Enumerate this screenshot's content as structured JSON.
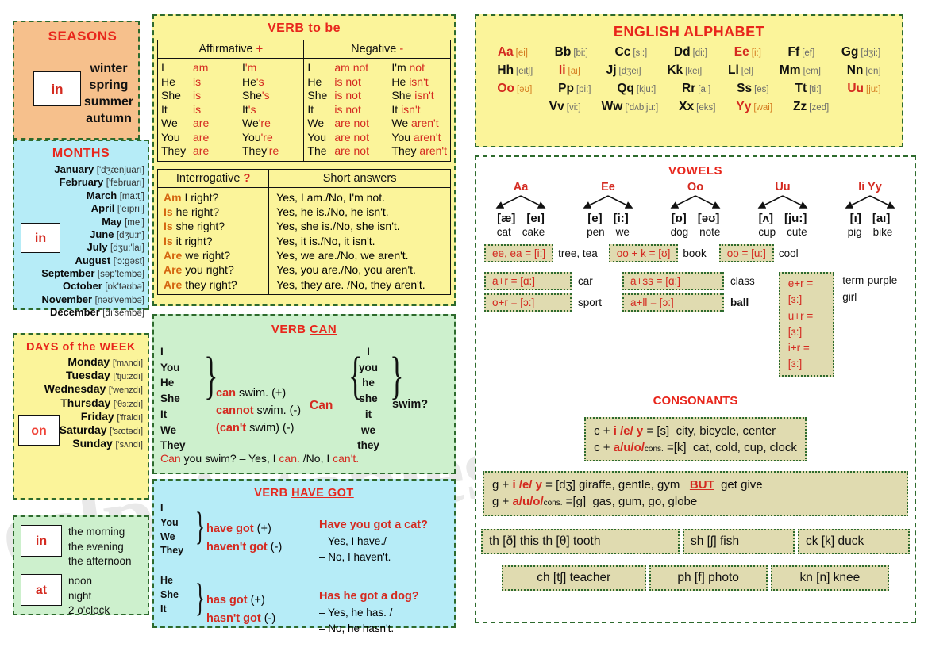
{
  "seasons": {
    "title": "SEASONS",
    "prep": "in",
    "items": [
      "winter",
      "spring",
      "summer",
      "autumn"
    ]
  },
  "months": {
    "title": "MONTHS",
    "prep": "in",
    "items": [
      {
        "name": "January",
        "ipa": "['dʒænjuarı]"
      },
      {
        "name": "February",
        "ipa": "['februarı]"
      },
      {
        "name": "March",
        "ipa": "[ma:tʃ]"
      },
      {
        "name": "April",
        "ipa": "['eıprıl]"
      },
      {
        "name": "May",
        "ipa": "[mei]"
      },
      {
        "name": "June",
        "ipa": "[dʒu:n]"
      },
      {
        "name": "July",
        "ipa": "[dʒu:'laı]"
      },
      {
        "name": "August",
        "ipa": "['ɔ:gəst]"
      },
      {
        "name": "September",
        "ipa": "[səp'tembə]"
      },
      {
        "name": "October",
        "ipa": "[ɒk'təʊbə]"
      },
      {
        "name": "November",
        "ipa": "[nəʊ'vembə]"
      },
      {
        "name": "December",
        "ipa": "[dı'sembə]"
      }
    ]
  },
  "days": {
    "title": "DAYS of the WEEK",
    "prep": "on",
    "items": [
      {
        "name": "Monday",
        "ipa": "['mʌndı]"
      },
      {
        "name": "Tuesday",
        "ipa": "['tju:zdı]"
      },
      {
        "name": "Wednesday",
        "ipa": "['wenzdı]"
      },
      {
        "name": "Thursday",
        "ipa": "['θɜ:zdı]"
      },
      {
        "name": "Friday",
        "ipa": "['fraidı]"
      },
      {
        "name": "Saturday",
        "ipa": "['sætədı]"
      },
      {
        "name": "Sunday",
        "ipa": "['sʌndı]"
      }
    ]
  },
  "timebox": {
    "prep_in": "in",
    "in_items": [
      "the morning",
      "the evening",
      "the afternoon"
    ],
    "prep_at": "at",
    "at_items": [
      "noon",
      "night",
      "2 o'clock"
    ]
  },
  "tobe": {
    "title_plain": "VERB ",
    "title_underlined": "to be",
    "head_affirmative": "Affirmative",
    "head_affirmative_sign": "+",
    "head_negative": "Negative",
    "head_negative_sign": "-",
    "affirmative": [
      {
        "subj": "I",
        "verb": "am",
        "short": "I'm"
      },
      {
        "subj": "He",
        "verb": "is",
        "short": "He's"
      },
      {
        "subj": "She",
        "verb": "is",
        "short": "She's"
      },
      {
        "subj": "It",
        "verb": "is",
        "short": "It's"
      },
      {
        "subj": "We",
        "verb": "are",
        "short": "We're"
      },
      {
        "subj": "You",
        "verb": "are",
        "short": "You're"
      },
      {
        "subj": "They",
        "verb": "are",
        "short": "They're"
      }
    ],
    "negative": [
      {
        "subj": "I",
        "verb": "am not",
        "short_subj": "I'm",
        "short_verb": "not"
      },
      {
        "subj": "He",
        "verb": "is not",
        "short_subj": "He",
        "short_verb": "isn't"
      },
      {
        "subj": "She",
        "verb": "is not",
        "short_subj": "She",
        "short_verb": "isn't"
      },
      {
        "subj": "It",
        "verb": "is not",
        "short_subj": "It",
        "short_verb": "isn't"
      },
      {
        "subj": "We",
        "verb": "are not",
        "short_subj": "We",
        "short_verb": "aren't"
      },
      {
        "subj": "You",
        "verb": "are not",
        "short_subj": "You",
        "short_verb": "aren't"
      },
      {
        "subj": "The",
        "verb": "are not",
        "short_subj": "They",
        "short_verb": "aren't"
      }
    ],
    "head_interrogative": "Interrogative",
    "head_interrogative_sign": "?",
    "head_short_answers": "Short answers",
    "qa": [
      {
        "q_word": "Am",
        "q_rest": "I right?",
        "a": "Yes, I am./No, I'm not."
      },
      {
        "q_word": "Is",
        "q_rest": "he right?",
        "a": "Yes, he is./No, he isn't."
      },
      {
        "q_word": "Is",
        "q_rest": "she right?",
        "a": "Yes, she is./No, she isn't."
      },
      {
        "q_word": "Is",
        "q_rest": "it right?",
        "a": "Yes, it is./No, it isn't."
      },
      {
        "q_word": "Are",
        "q_rest": "we right?",
        "a": "Yes, we are./No, we aren't."
      },
      {
        "q_word": "Are",
        "q_rest": "you right?",
        "a": "Yes, you are./No, you aren't."
      },
      {
        "q_word": "Are",
        "q_rest": "they right?",
        "a": "Yes, they are. /No, they aren't."
      }
    ]
  },
  "verbcan": {
    "title_plain": "VERB  ",
    "title_underlined": "CAN",
    "pronouns_left": [
      "I",
      "You",
      "He",
      "She",
      "It",
      "We",
      "They"
    ],
    "forms": [
      {
        "modal": "can",
        "rest": " swim. (+)"
      },
      {
        "modal": "cannot",
        "rest": " swim. (-)"
      },
      {
        "modal": "(can't",
        "rest": " swim)  (-)"
      }
    ],
    "question_word": "Can",
    "pronouns_right": [
      "I",
      "you",
      "he",
      "she",
      "it",
      "we",
      "they"
    ],
    "question_verb": "swim?",
    "example_q": "Can",
    "example_rest": " you swim? – Yes, I ",
    "example_yes": "can.",
    "example_mid": " /No, I ",
    "example_no": "can't."
  },
  "havegot": {
    "title_plain": "VERB  ",
    "title_underlined": "HAVE GOT",
    "group1_pronouns": [
      "I",
      "You",
      "We",
      "They"
    ],
    "group1_forms": [
      {
        "form": "have got",
        "sign": "(+)"
      },
      {
        "form": "haven't got",
        "sign": "(-)"
      }
    ],
    "group1_question": "Have you got a cat?",
    "group1_answers": [
      "– Yes, I  have./",
      "– No, I haven't."
    ],
    "group2_pronouns": [
      "He",
      "She",
      "It"
    ],
    "group2_forms": [
      {
        "form": "has got",
        "sign": "(+)"
      },
      {
        "form": "hasn't got",
        "sign": "(-)"
      }
    ],
    "group2_question": "Has he got a dog?",
    "group2_answers": [
      "– Yes, he has. /",
      "– No, he hasn't."
    ]
  },
  "alphabet": {
    "title": "ENGLISH ALPHABET",
    "rows": [
      [
        {
          "letter": "Aa",
          "ipa": "[ei]",
          "vowel": true
        },
        {
          "letter": "Bb",
          "ipa": "[bi:]",
          "vowel": false
        },
        {
          "letter": "Cc",
          "ipa": "[si:]",
          "vowel": false
        },
        {
          "letter": "Dd",
          "ipa": "[di:]",
          "vowel": false
        },
        {
          "letter": "Ee",
          "ipa": "[i:]",
          "vowel": true
        },
        {
          "letter": "Ff",
          "ipa": "[ef]",
          "vowel": false
        },
        {
          "letter": "Gg",
          "ipa": "[dʒi:]",
          "vowel": false
        }
      ],
      [
        {
          "letter": "Hh",
          "ipa": "[eitʃ]",
          "vowel": false
        },
        {
          "letter": "Ii",
          "ipa": "[ai]",
          "vowel": true
        },
        {
          "letter": "Jj",
          "ipa": "[dʒei]",
          "vowel": false
        },
        {
          "letter": "Kk",
          "ipa": "[kei]",
          "vowel": false
        },
        {
          "letter": "Ll",
          "ipa": "[el]",
          "vowel": false
        },
        {
          "letter": "Mm",
          "ipa": "[em]",
          "vowel": false
        },
        {
          "letter": "Nn",
          "ipa": "[en]",
          "vowel": false
        }
      ],
      [
        {
          "letter": "Oo",
          "ipa": "[əʊ]",
          "vowel": true
        },
        {
          "letter": "Pp",
          "ipa": "[pi:]",
          "vowel": false
        },
        {
          "letter": "Qq",
          "ipa": "[kju:]",
          "vowel": false
        },
        {
          "letter": "Rr",
          "ipa": "[a:]",
          "vowel": false
        },
        {
          "letter": "Ss",
          "ipa": "[es]",
          "vowel": false
        },
        {
          "letter": "Tt",
          "ipa": "[ti:]",
          "vowel": false
        },
        {
          "letter": "Uu",
          "ipa": "[ju:]",
          "vowel": true
        }
      ],
      [
        {
          "letter": "Vv",
          "ipa": "[vi:]",
          "vowel": false
        },
        {
          "letter": "Ww",
          "ipa": "['dʌblju:]",
          "vowel": false
        },
        {
          "letter": "Xx",
          "ipa": "[eks]",
          "vowel": false
        },
        {
          "letter": "Yy",
          "ipa": "[wai]",
          "vowel": true
        },
        {
          "letter": "Zz",
          "ipa": "[zed]",
          "vowel": false
        }
      ]
    ]
  },
  "vowels": {
    "title": "VOWELS",
    "groups": [
      {
        "head": "Aa",
        "left_ipa": "[æ]",
        "left_word": "cat",
        "right_ipa": "[eı]",
        "right_word": "cake"
      },
      {
        "head": "Ee",
        "left_ipa": "[e]",
        "left_word": "pen",
        "right_ipa": "[i:]",
        "right_word": "we"
      },
      {
        "head": "Oo",
        "left_ipa": "[ɒ]",
        "left_word": "dog",
        "right_ipa": "[əʊ]",
        "right_word": "note"
      },
      {
        "head": "Uu",
        "left_ipa": "[ʌ]",
        "left_word": "cup",
        "right_ipa": "[ju:]",
        "right_word": "cute"
      },
      {
        "head": "Ii Yy",
        "left_ipa": "[ı]",
        "left_word": "pig",
        "right_ipa": "[aı]",
        "right_word": "bike"
      }
    ],
    "rules_row1": [
      {
        "rule": "ee, ea = [i:]",
        "examples": "tree, tea"
      },
      {
        "rule": "oo + k = [ʊ]",
        "examples": "book"
      },
      {
        "rule": "oo = [u:]",
        "examples": "cool"
      }
    ],
    "rules_row2_col1": [
      {
        "rule": "a+r = [ɑ:]",
        "examples": "car"
      },
      {
        "rule": "o+r = [ɔ:]",
        "examples": "sport"
      }
    ],
    "rules_row2_col2": [
      {
        "rule": "a+ss = [ɑ:]",
        "examples": "class"
      },
      {
        "rule": "a+ll = [ɔ:]",
        "examples": "ball"
      }
    ],
    "rules_row2_col3": {
      "rules": [
        "e+r = [ɜ:]",
        "u+r = [ɜ:]",
        "i+r = [ɜ:]"
      ],
      "examples": [
        "term",
        "purple",
        "girl"
      ]
    }
  },
  "consonants": {
    "title": "CONSONANTS",
    "c_rules": [
      {
        "pre": "c + ",
        "mid": "i /e/ y",
        "eq": " =  [s]",
        "examples": "city, bicycle, center"
      },
      {
        "pre": "c + ",
        "mid": "a/u/o/",
        "sub": "cons.",
        "eq": " =[k]",
        "examples": "cat, cold, cup, clock"
      }
    ],
    "g_rules": [
      {
        "pre": "g + ",
        "mid": "i /e/ y",
        "eq": " =   [dʒ]",
        "examples": "giraffe, gentle, gym",
        "but": "BUT",
        "but_examples": "get  give"
      },
      {
        "pre": "g + ",
        "mid": "a/u/o/",
        "sub": "cons.",
        "eq": " =[g]",
        "examples": "gas, gum, go, globe"
      }
    ],
    "digraphs_row1": [
      {
        "text": "th [ð]   this    th [θ] tooth"
      },
      {
        "text": "sh [ʃ]  fish"
      },
      {
        "text": "ck [k]  duck"
      }
    ],
    "digraphs_row2": [
      {
        "text": "ch [tʃ]  teacher"
      },
      {
        "text": "ph [f] photo"
      },
      {
        "text": "kn [n]  knee"
      }
    ]
  },
  "watermark": "eslprintables.com",
  "colors": {
    "accent_red": "#d42a20",
    "title_red": "#e8261c",
    "border_green": "#2d6a2d",
    "seasons_bg": "#f6c08c",
    "months_bg": "#b6ecf7",
    "days_bg": "#fbf49a",
    "green_bg": "#cdf0cd",
    "tan_bg": "#e0dbb0"
  }
}
